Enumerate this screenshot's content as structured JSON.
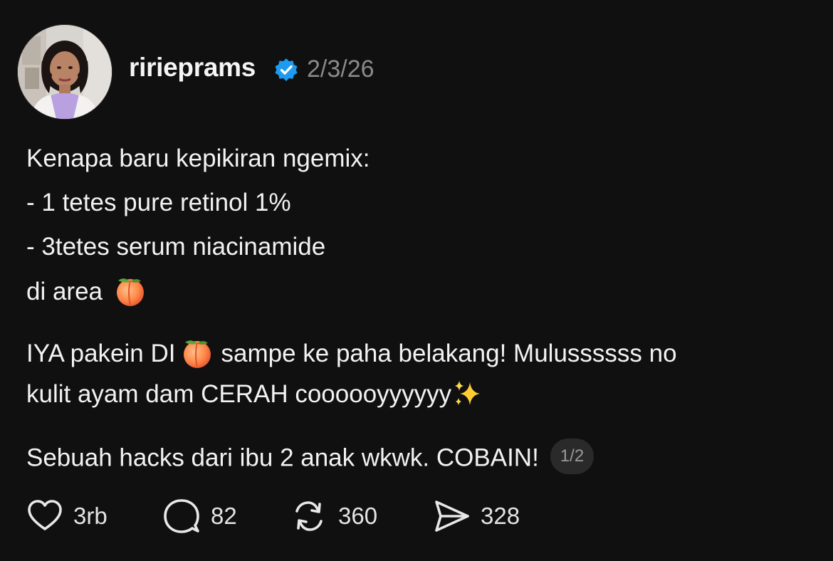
{
  "author": {
    "username": "ririeprams",
    "verified": true,
    "date": "2/3/26"
  },
  "post": {
    "line1": "Kenapa baru kepikiran ngemix:",
    "line2": "- 1 tetes pure retinol 1%",
    "line3": "- 3tetes serum niacinamide",
    "line4": "di area",
    "line5a": "IYA pakein DI",
    "line5b": "sampe ke paha belakang! Mulussssss no",
    "line6": "kulit ayam dam CERAH coooooyyyyyy",
    "line7": "Sebuah hacks dari ibu 2 anak wkwk. COBAIN!",
    "page_indicator": "1/2"
  },
  "actions": {
    "likes": "3rb",
    "comments": "82",
    "reposts": "360",
    "shares": "328"
  },
  "icons": {
    "verified": "verified-badge-icon",
    "emoji_peach": "peach-emoji",
    "emoji_sparkles": "sparkles-emoji",
    "like": "heart-icon",
    "comment": "comment-bubble-icon",
    "repost": "repost-icon",
    "share": "send-icon"
  },
  "colors": {
    "background": "#101010",
    "text": "#f2f2f2",
    "muted": "#8a8a8a",
    "verified": "#1d9bf0"
  }
}
